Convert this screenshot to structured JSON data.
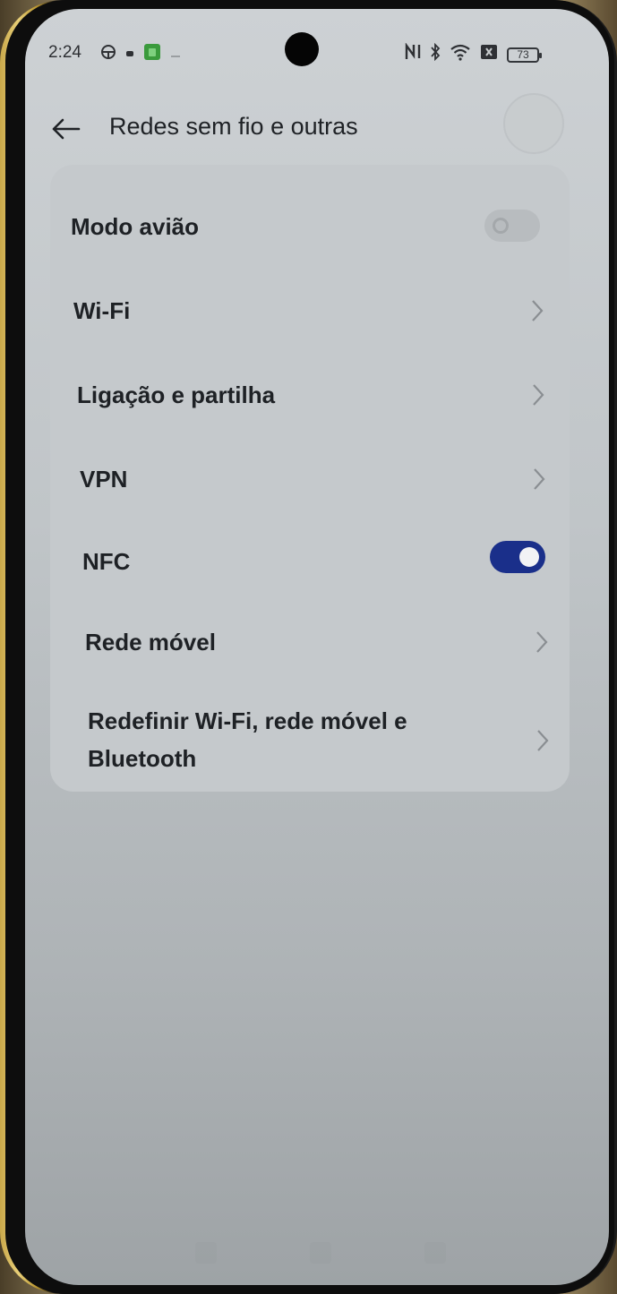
{
  "status_bar": {
    "time": "2:24",
    "battery": "73",
    "left_icons": [
      "steering-wheel-icon",
      "small-dot-icon",
      "green-app-icon",
      "minus-icon"
    ],
    "right_icons": [
      "nfc-icon",
      "bluetooth-icon",
      "wifi-icon",
      "sim-x-icon"
    ]
  },
  "header": {
    "title": "Redes sem fio e outras"
  },
  "settings": {
    "items": [
      {
        "label": "Modo avião",
        "control": "toggle",
        "state": "off"
      },
      {
        "label": "Wi-Fi",
        "control": "chevron"
      },
      {
        "label": "Ligação e partilha",
        "control": "chevron"
      },
      {
        "label": "VPN",
        "control": "chevron"
      },
      {
        "label": "NFC",
        "control": "toggle",
        "state": "on"
      },
      {
        "label": "Rede móvel",
        "control": "chevron"
      },
      {
        "label": "Redefinir Wi-Fi, rede móvel e Bluetooth",
        "control": "chevron"
      }
    ]
  },
  "colors": {
    "toggle_on": "#1a2f8a",
    "screen_bg": "#c5c9cc",
    "text": "#1e2125"
  }
}
